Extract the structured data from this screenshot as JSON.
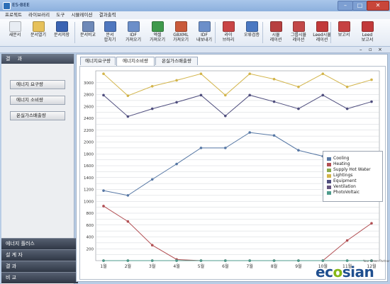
{
  "app": {
    "title": "ES-BEE"
  },
  "menu": [
    "프로젝트",
    "라이브러리",
    "도구",
    "시뮬레이션",
    "결과출력"
  ],
  "toolbar": [
    {
      "label": "새문서",
      "icon": "new-doc-icon",
      "color": "#e8edf3"
    },
    {
      "label": "문서열기",
      "icon": "open-folder-icon",
      "color": "#e6c15a"
    },
    {
      "label": "문서저장",
      "icon": "save-icon",
      "color": "#3a63b3"
    },
    {
      "label": "문서비교",
      "icon": "compare-icon",
      "color": "#6e89b8"
    },
    {
      "label": "문서\n합치기",
      "icon": "merge-icon",
      "color": "#4f77bf"
    },
    {
      "label": "IDF\n가져오기",
      "icon": "idf-import-icon",
      "color": "#6c8fc9"
    },
    {
      "label": "엑셀\n가져오기",
      "icon": "excel-import-icon",
      "color": "#3f9a4b"
    },
    {
      "label": "GBXML\n가져오기",
      "icon": "gbxml-import-icon",
      "color": "#c95a3a"
    },
    {
      "label": "IDF\n내보내기",
      "icon": "idf-export-icon",
      "color": "#6c8fc9"
    },
    {
      "label": "라이\n브러리",
      "icon": "library-icon",
      "color": "#c94545"
    },
    {
      "label": "오류검증",
      "icon": "validation-icon",
      "color": "#4a78c2"
    },
    {
      "label": "시뮬\n레이션",
      "icon": "simulation-icon",
      "color": "#b74040"
    },
    {
      "label": "그룹시뮬\n레이션",
      "icon": "group-simulation-icon",
      "color": "#c24848"
    },
    {
      "label": "Leed시뮬\n레이션",
      "icon": "leed-simulation-icon",
      "color": "#c23a3a"
    },
    {
      "label": "보고서",
      "icon": "report-icon",
      "color": "#c64242"
    },
    {
      "label": "Leed\n보고서",
      "icon": "leed-report-icon",
      "color": "#c23a3a"
    }
  ],
  "left_panel": {
    "header": "결 과",
    "buttons": [
      "에너지 요구량",
      "에너지 소비량",
      "온실가스배출량"
    ],
    "bottom": [
      "에너지 플러스",
      "설 계 자",
      "결 과",
      "비 교"
    ]
  },
  "tabs": [
    "에너지요구량",
    "에너지소비량",
    "온실가스배출량"
  ],
  "active_tab": 1,
  "logo": {
    "text": "ecosian",
    "tagline": "Your Green Partner"
  },
  "chart_data": {
    "type": "line",
    "categories": [
      "1월",
      "2월",
      "3월",
      "4월",
      "5월",
      "6월",
      "7월",
      "8월",
      "9월",
      "10월",
      "11월",
      "12월"
    ],
    "ylim": [
      0,
      3200
    ],
    "yticks": [
      100,
      200,
      300,
      400,
      500,
      600,
      700,
      800,
      900,
      1000,
      1100,
      1200,
      1300,
      1400,
      1500,
      1600,
      1700,
      1800,
      1900,
      2000,
      2100,
      2200,
      2300,
      2400,
      2500,
      2600,
      2700,
      2800,
      2900,
      3000
    ],
    "series": [
      {
        "name": "Cooling",
        "color": "#5677a4",
        "values": [
          1180,
          1100,
          1370,
          1630,
          1900,
          1900,
          2160,
          2110,
          1860,
          1760,
          1220,
          1180
        ]
      },
      {
        "name": "Heating",
        "color": "#b24f53",
        "values": [
          920,
          660,
          260,
          20,
          0,
          0,
          0,
          0,
          0,
          0,
          340,
          630
        ]
      },
      {
        "name": "Supply Hot Water",
        "color": "#87a94d",
        "values": [
          0,
          0,
          0,
          0,
          0,
          0,
          0,
          0,
          0,
          0,
          0,
          0
        ]
      },
      {
        "name": "Lightings",
        "color": "#d2b44a",
        "values": [
          3150,
          2780,
          2940,
          3040,
          3150,
          2790,
          3150,
          3060,
          2930,
          3150,
          2930,
          3050
        ]
      },
      {
        "name": "Equipment",
        "color": "#4f4e7e",
        "values": [
          2790,
          2430,
          2560,
          2670,
          2790,
          2440,
          2790,
          2680,
          2560,
          2790,
          2560,
          2680
        ]
      },
      {
        "name": "Ventilation",
        "color": "#66547f",
        "values": [
          0,
          0,
          0,
          0,
          0,
          0,
          0,
          0,
          0,
          0,
          0,
          0
        ]
      },
      {
        "name": "PhotoVoltaic",
        "color": "#4e9b8c",
        "values": [
          0,
          0,
          0,
          0,
          0,
          0,
          0,
          0,
          0,
          0,
          0,
          0
        ]
      }
    ]
  }
}
